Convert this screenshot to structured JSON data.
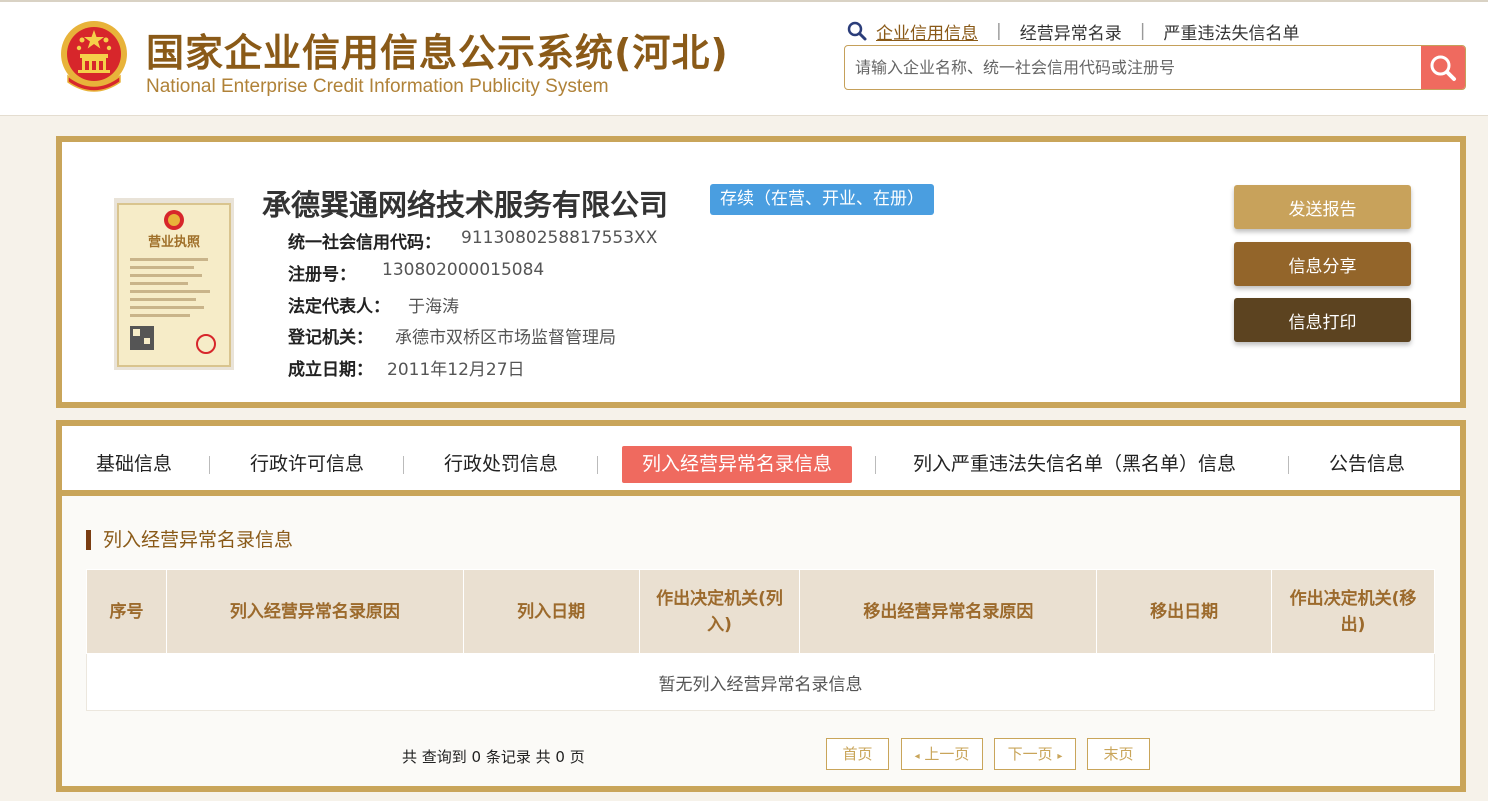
{
  "header": {
    "title_cn": "国家企业信用信息公示系统(河北)",
    "title_en": "National Enterprise Credit Information Publicity System",
    "nav": [
      {
        "label": "企业信用信息",
        "active": true
      },
      {
        "label": "经营异常名录",
        "active": false
      },
      {
        "label": "严重违法失信名单",
        "active": false
      }
    ],
    "separator": "|",
    "search_placeholder": "请输入企业名称、统一社会信用代码或注册号"
  },
  "company": {
    "name": "承德巽通网络技术服务有限公司",
    "status": "存续（在营、开业、在册）",
    "credit_code_label": "统一社会信用代码：",
    "credit_code": "9113080258817553XX",
    "reg_no_label": "注册号：",
    "reg_no": "130802000015084",
    "legal_rep_label": "法定代表人：",
    "legal_rep": "于海涛",
    "authority_label": "登记机关：",
    "authority": "承德市双桥区市场监督管理局",
    "established_label": "成立日期：",
    "established": "2011年12月27日",
    "license_title": "营业执照"
  },
  "actions": {
    "send_report": "发送报告",
    "share": "信息分享",
    "print": "信息打印"
  },
  "tabs": [
    {
      "label": "基础信息",
      "active": false
    },
    {
      "label": "行政许可信息",
      "active": false
    },
    {
      "label": "行政处罚信息",
      "active": false
    },
    {
      "label": "列入经营异常名录信息",
      "active": true
    },
    {
      "label": "列入严重违法失信名单（黑名单）信息",
      "active": false
    },
    {
      "label": "公告信息",
      "active": false
    }
  ],
  "section": {
    "title": "列入经营异常名录信息",
    "columns": [
      "序号",
      "列入经营异常名录原因",
      "列入日期",
      "作出决定机关(列入)",
      "移出经营异常名录原因",
      "移出日期",
      "作出决定机关(移出)"
    ],
    "empty_message": "暂无列入经营异常名录信息"
  },
  "pagination": {
    "summary": "共 查询到 0 条记录 共 0 页",
    "first": "首页",
    "prev": "上一页",
    "next": "下一页",
    "last": "末页"
  },
  "colors": {
    "brand_gold": "#c9a55a",
    "title_brown": "#8a5a18",
    "accent_red": "#ef6a5f",
    "status_blue": "#4a9ee0",
    "btn_send": "#c8a25b",
    "btn_share": "#93652a",
    "btn_print": "#5c4320"
  }
}
